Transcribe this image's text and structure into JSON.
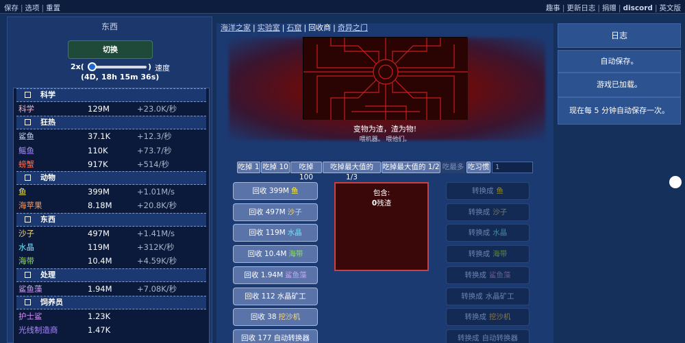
{
  "topbar": {
    "left": [
      "保存",
      "选项",
      "重置"
    ],
    "right": [
      "趣事",
      "更新日志",
      "捐赠",
      "discord",
      "英文版"
    ]
  },
  "left_panel": {
    "title": "东西",
    "toggle_label": "切换",
    "speed_multiplier": "2x(",
    "speed_close": ")",
    "speed_label": "速度",
    "speed_level": 0.0,
    "time_remaining": "(4D, 18h 15m 36s)"
  },
  "resources": [
    {
      "header": "科学",
      "rows": [
        {
          "name": "科学",
          "amount": "129M",
          "rate": "+23.0K/秒",
          "color": "#f2b7cc"
        }
      ]
    },
    {
      "header": "狂热",
      "rows": [
        {
          "name": "鲨鱼",
          "amount": "37.1K",
          "rate": "+12.3/秒",
          "color": "#c8d4ee"
        },
        {
          "name": "鳐鱼",
          "amount": "110K",
          "rate": "+73.7/秒",
          "color": "#a78bfa"
        },
        {
          "name": "螃蟹",
          "amount": "917K",
          "rate": "+514/秒",
          "color": "#ff6b4a"
        }
      ]
    },
    {
      "header": "动物",
      "rows": [
        {
          "name": "鱼",
          "amount": "399M",
          "rate": "+1.01M/s",
          "color": "#f5e94a"
        },
        {
          "name": "海苹果",
          "amount": "8.18M",
          "rate": "+20.8K/秒",
          "color": "#ff9a5a"
        }
      ]
    },
    {
      "header": "东西",
      "rows": [
        {
          "name": "沙子",
          "amount": "497M",
          "rate": "+1.41M/s",
          "color": "#f3d88a"
        },
        {
          "name": "水晶",
          "amount": "119M",
          "rate": "+312K/秒",
          "color": "#6fe3ff"
        },
        {
          "name": "海带",
          "amount": "10.4M",
          "rate": "+4.59K/秒",
          "color": "#8fe05a"
        }
      ]
    },
    {
      "header": "处理",
      "rows": [
        {
          "name": "鲨鱼藻",
          "amount": "1.94M",
          "rate": "+7.08K/秒",
          "color": "#c8a0f0"
        }
      ]
    },
    {
      "header": "饲养员",
      "rows": [
        {
          "name": "护士鲨",
          "amount": "1.23K",
          "rate": "",
          "color": "#d38cf5"
        },
        {
          "name": "光线制造商",
          "amount": "1.47K",
          "rate": "",
          "color": "#a78bfa"
        }
      ]
    }
  ],
  "center": {
    "tabs": [
      "海洋之家",
      "实验室",
      "石窟",
      "回收商",
      "奇异之门"
    ],
    "active_tab": "回收商",
    "scene_text": "变物为渣，渣为物!",
    "scene_sub": "喂机器。 喂他们。",
    "eat_buttons": [
      "吃掉 1",
      "吃掉 10",
      "吃掉 100",
      "吃掉最大值的 1/3",
      "吃掉最大值的 1/2",
      "吃最多",
      "吃习惯"
    ],
    "eat_input_value": "1",
    "recycle": [
      {
        "prefix": "回收 399M",
        "item": "鱼",
        "color": "#f5e94a"
      },
      {
        "prefix": "回收 497M",
        "item": "沙子",
        "color": "#f3d88a"
      },
      {
        "prefix": "回收 119M",
        "item": "水晶",
        "color": "#6fe3ff"
      },
      {
        "prefix": "回收 10.4M",
        "item": "海带",
        "color": "#8fe05a"
      },
      {
        "prefix": "回收 1.94M",
        "item": "鲨鱼藻",
        "color": "#c8a0f0"
      },
      {
        "prefix": "回收 112",
        "item": "水晶矿工",
        "color": "#ffffff"
      },
      {
        "prefix": "回收 38",
        "item": "挖沙机",
        "color": "#f3d88a"
      },
      {
        "prefix": "回收 177",
        "item": "自动转换器",
        "color": "#ffffff"
      }
    ],
    "container_label": "包含:",
    "container_amount": "0",
    "container_unit": "残渣",
    "convert": [
      {
        "prefix": "转换成",
        "item": "鱼",
        "color": "#8a8a3a"
      },
      {
        "prefix": "转换成",
        "item": "沙子",
        "color": "#8a7a4a"
      },
      {
        "prefix": "转换成",
        "item": "水晶",
        "color": "#4a8aa0"
      },
      {
        "prefix": "转换成",
        "item": "海带",
        "color": "#5a8a3a"
      },
      {
        "prefix": "转换成",
        "item": "鲨鱼藻",
        "color": "#6a5a8a"
      },
      {
        "prefix": "转换成",
        "item": "水晶矿工",
        "color": "#6d84b2"
      },
      {
        "prefix": "转换成",
        "item": "挖沙机",
        "color": "#8a7a4a"
      },
      {
        "prefix": "转换成",
        "item": "自动转换器",
        "color": "#6d84b2"
      }
    ]
  },
  "log": {
    "title": "日志",
    "entries": [
      "自动保存。",
      "游戏已加载。",
      "现在每 5 分钟自动保存一次。"
    ]
  }
}
